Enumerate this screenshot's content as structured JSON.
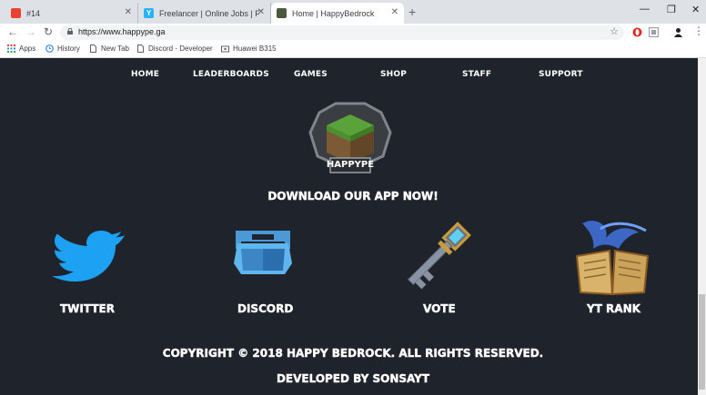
{
  "browser": {
    "tabs": [
      {
        "title": "#14"
      },
      {
        "title": "Freelancer | Online Jobs | Freelance"
      },
      {
        "title": "Home | HappyBedrock"
      }
    ],
    "url": "https://www.happype.ga",
    "bookmarks": [
      "Apps",
      "History",
      "New Tab",
      "Discord - Developer",
      "Huawei B315"
    ]
  },
  "site": {
    "nav": [
      "HOME",
      "LEADERBOARDS",
      "GAMES",
      "SHOP",
      "STAFF",
      "SUPPORT"
    ],
    "logo_text": "HAPPYPE",
    "download_heading": "DOWNLOAD OUR APP NOW!",
    "features": [
      {
        "label": "TWITTER",
        "icon": "twitter-bird-icon"
      },
      {
        "label": "DISCORD",
        "icon": "discord-icon"
      },
      {
        "label": "VOTE",
        "icon": "key-icon"
      },
      {
        "label": "YT RANK",
        "icon": "magic-book-icon"
      }
    ],
    "copyright": "COPYRIGHT © 2018 HAPPY BEDROCK. ALL RIGHTS RESERVED.",
    "developer": "DEVELOPED BY SONSAYT"
  }
}
